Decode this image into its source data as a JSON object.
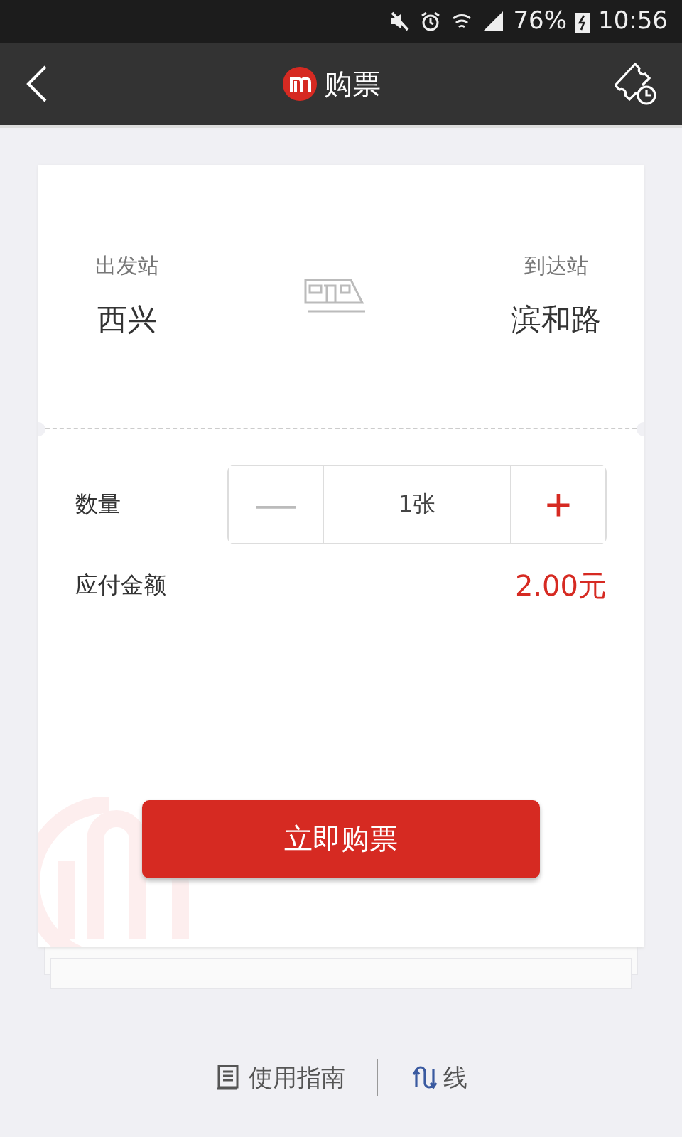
{
  "status_bar": {
    "battery": "76%",
    "time": "10:56"
  },
  "header": {
    "title": "购票"
  },
  "route": {
    "from_label": "出发站",
    "from": "西兴",
    "to_label": "到达站",
    "to": "滨和路"
  },
  "quantity": {
    "label": "数量",
    "minus": "—",
    "value": "1张",
    "plus": "+"
  },
  "amount": {
    "label": "应付金额",
    "value": "2.00元"
  },
  "buy_button": "立即购票",
  "footer_links": [
    {
      "kind": "guide",
      "label": "使用指南"
    },
    {
      "kind": "route",
      "label": "线"
    }
  ]
}
